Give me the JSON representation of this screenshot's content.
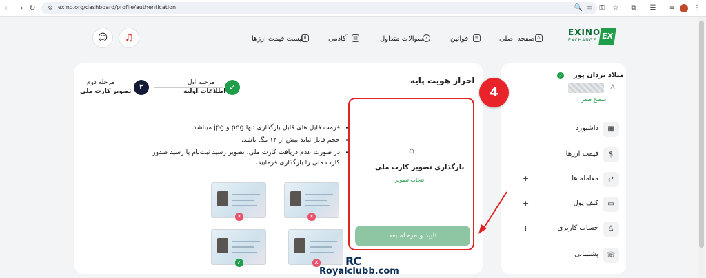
{
  "browser": {
    "url": "exino.org/dashboard/profile/authentication"
  },
  "logo": {
    "text": "EXINO",
    "sub": "EXCHANGE",
    "badge": "EX"
  },
  "nav": {
    "home": "صفحه اصلی",
    "rules": "قوانین",
    "faq": "سوالات متداول",
    "academy": "آکادمی",
    "prices": "لیست قیمت ارزها"
  },
  "sidebar": {
    "user_name": "میلاد یزدان پور",
    "level": "سطح صفر",
    "items": [
      {
        "label": "داشبورد",
        "icon": "dashboard-icon",
        "plus": ""
      },
      {
        "label": "قیمت ارزها",
        "icon": "price-icon",
        "plus": ""
      },
      {
        "label": "معامله ها",
        "icon": "trade-icon",
        "plus": "+"
      },
      {
        "label": "کیف پول",
        "icon": "wallet-icon",
        "plus": "+"
      },
      {
        "label": "حساب کاربری",
        "icon": "user-icon",
        "plus": "+"
      },
      {
        "label": "پشتیبانی",
        "icon": "support-icon",
        "plus": ""
      }
    ]
  },
  "main": {
    "title": "احراز هویت پایه",
    "step_badge": "4",
    "step1": {
      "title": "مرحله اول",
      "subtitle": "اطلاعات اولیه"
    },
    "step2": {
      "number": "۲",
      "title": "مرحله دوم",
      "subtitle": "تصویر کارت ملی"
    },
    "rules": [
      "فرمت فایل های قابل بارگذاری تنها png و jpg میباشد.",
      "حجم فایل نباید بیش از ۱۲ مگ باشد.",
      "در صورت عدم دریافت کارت ملی، تصویر رسید ثبت‌نام یا رسید صدور کارت ملی را بارگذاری فرمایید."
    ],
    "upload": {
      "title": "بارگذاری تصویر کارت ملی",
      "link": "انتخاب تصویر",
      "next_button": "تایید و مرحله بعد"
    }
  },
  "watermark": {
    "logo": "RC",
    "site": "Royalclubb.com"
  },
  "colors": {
    "brand": "#1f9d48",
    "highlight": "#e02424",
    "dark": "#131a38"
  }
}
